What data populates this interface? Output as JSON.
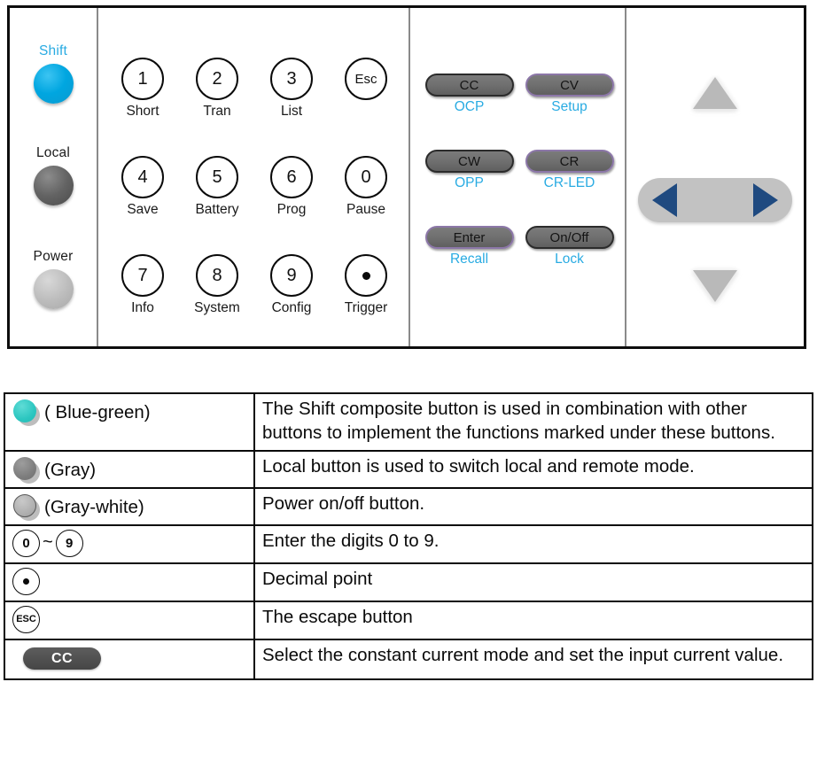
{
  "panel": {
    "side_buttons": [
      {
        "label": "Shift",
        "label_color": "#29abe2",
        "led": "shift-led",
        "led_color": "#00a6e0"
      },
      {
        "label": "Local",
        "label_color": "#1a1a1a",
        "led": "local-led",
        "led_color": "#636363"
      },
      {
        "label": "Power",
        "label_color": "#1a1a1a",
        "led": "power-led",
        "led_color": "#bdbdbd"
      }
    ],
    "keypad": [
      {
        "key": "1",
        "sub": "Short"
      },
      {
        "key": "2",
        "sub": "Tran"
      },
      {
        "key": "3",
        "sub": "List"
      },
      {
        "key": "Esc",
        "sub": ""
      },
      {
        "key": "4",
        "sub": "Save"
      },
      {
        "key": "5",
        "sub": "Battery"
      },
      {
        "key": "6",
        "sub": "Prog"
      },
      {
        "key": "0",
        "sub": "Pause"
      },
      {
        "key": "7",
        "sub": "Info"
      },
      {
        "key": "8",
        "sub": "System"
      },
      {
        "key": "9",
        "sub": "Config"
      },
      {
        "key": "dot-icon",
        "sub": "Trigger"
      }
    ],
    "modes": [
      {
        "label": "CC",
        "sub": "OCP",
        "border": "dark"
      },
      {
        "label": "CV",
        "sub": "Setup",
        "border": "violet"
      },
      {
        "label": "CW",
        "sub": "OPP",
        "border": "dark"
      },
      {
        "label": "CR",
        "sub": "CR-LED",
        "border": "violet"
      },
      {
        "label": "Enter",
        "sub": "Recall",
        "border": "violet"
      },
      {
        "label": "On/Off",
        "sub": "Lock",
        "border": "dark"
      }
    ],
    "arrows": {
      "up": "arrow-up-icon",
      "down": "arrow-down-icon",
      "left": "arrow-left-icon",
      "right": "arrow-right-icon",
      "triangle_gray": "#b9b9b9",
      "rocker_bg": "#c2c2c2",
      "rocker_arrow_color": "#1f4a80"
    }
  },
  "table": {
    "rows": [
      {
        "symbol_type": "circle-teal",
        "caption": "( Blue-green)",
        "desc": "The Shift composite button is used in combination with other buttons to implement the functions marked under these buttons.",
        "justify": false
      },
      {
        "symbol_type": "circle-gray",
        "caption": "(Gray)",
        "desc": "Local button is used to switch local and remote mode.",
        "justify": true
      },
      {
        "symbol_type": "circle-gray-white",
        "caption": "(Gray-white)",
        "desc": "Power on/off button.",
        "justify": false
      },
      {
        "symbol_type": "digit-range",
        "range_from": "0",
        "range_to": "9",
        "range_sep": "~",
        "caption": "",
        "desc": "Enter the digits 0 to 9.",
        "justify": false
      },
      {
        "symbol_type": "decimal-key",
        "caption": "",
        "desc": "Decimal point",
        "justify": false
      },
      {
        "symbol_type": "esc-key",
        "esc_label": "ESC",
        "caption": "",
        "desc": "The escape button",
        "justify": false
      },
      {
        "symbol_type": "cc-pill",
        "pill_label": "CC",
        "caption": "",
        "desc": "Select the constant current mode and set the input current value.",
        "justify": false
      }
    ]
  }
}
